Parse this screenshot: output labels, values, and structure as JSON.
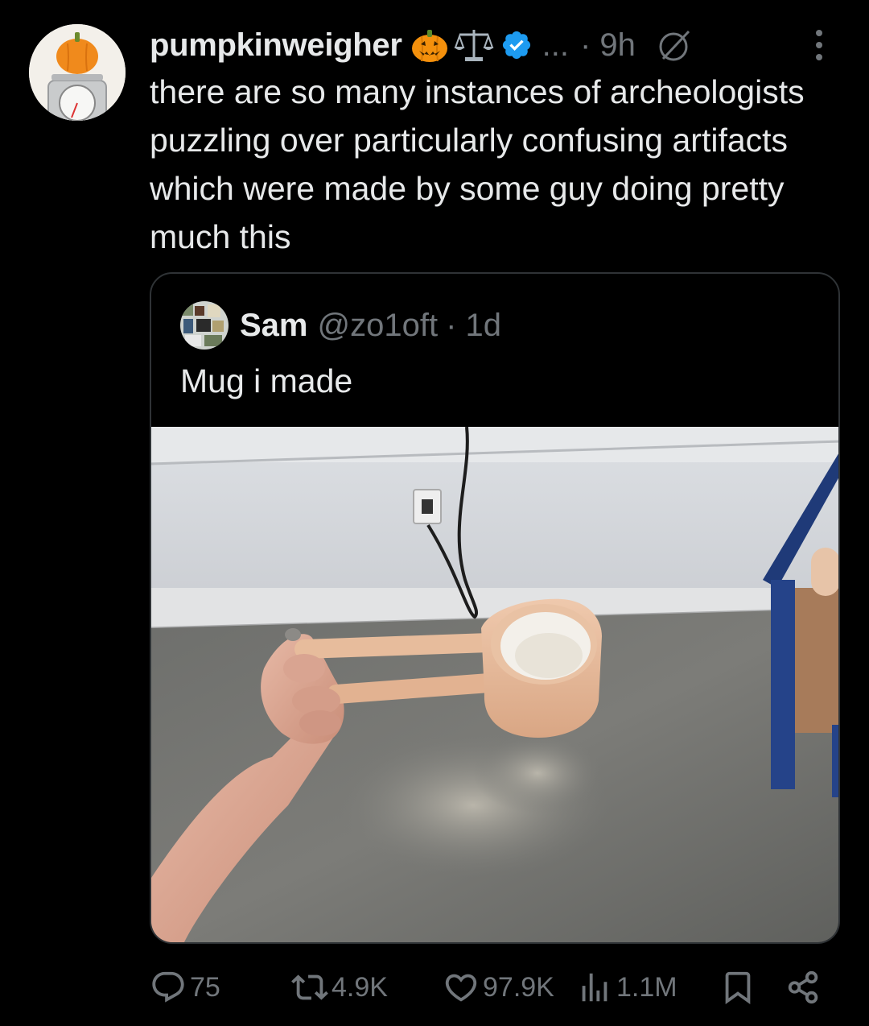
{
  "tweet": {
    "display_name": "pumpkinweigher",
    "more_indicator": "...",
    "time": "· 9h",
    "text": "there are so many instances of archeologists puzzling over particularly confusing artifacts which were made by some guy doing pretty much this"
  },
  "quote": {
    "name": "Sam",
    "handle": "@zo1oft",
    "time": "· 1d",
    "text": "Mug i made"
  },
  "actions": {
    "replies": "75",
    "reposts": "4.9K",
    "likes": "97.9K",
    "views": "1.1M"
  },
  "colors": {
    "background": "#000000",
    "text": "#e7e9ea",
    "muted": "#71767b",
    "verified": "#1d9bf0",
    "border": "#2f3336"
  },
  "icons": [
    "pumpkin-icon",
    "scales-icon",
    "verified-badge-icon",
    "grok-icon",
    "more-icon",
    "reply-icon",
    "repost-icon",
    "like-icon",
    "views-icon",
    "bookmark-icon",
    "share-icon"
  ]
}
